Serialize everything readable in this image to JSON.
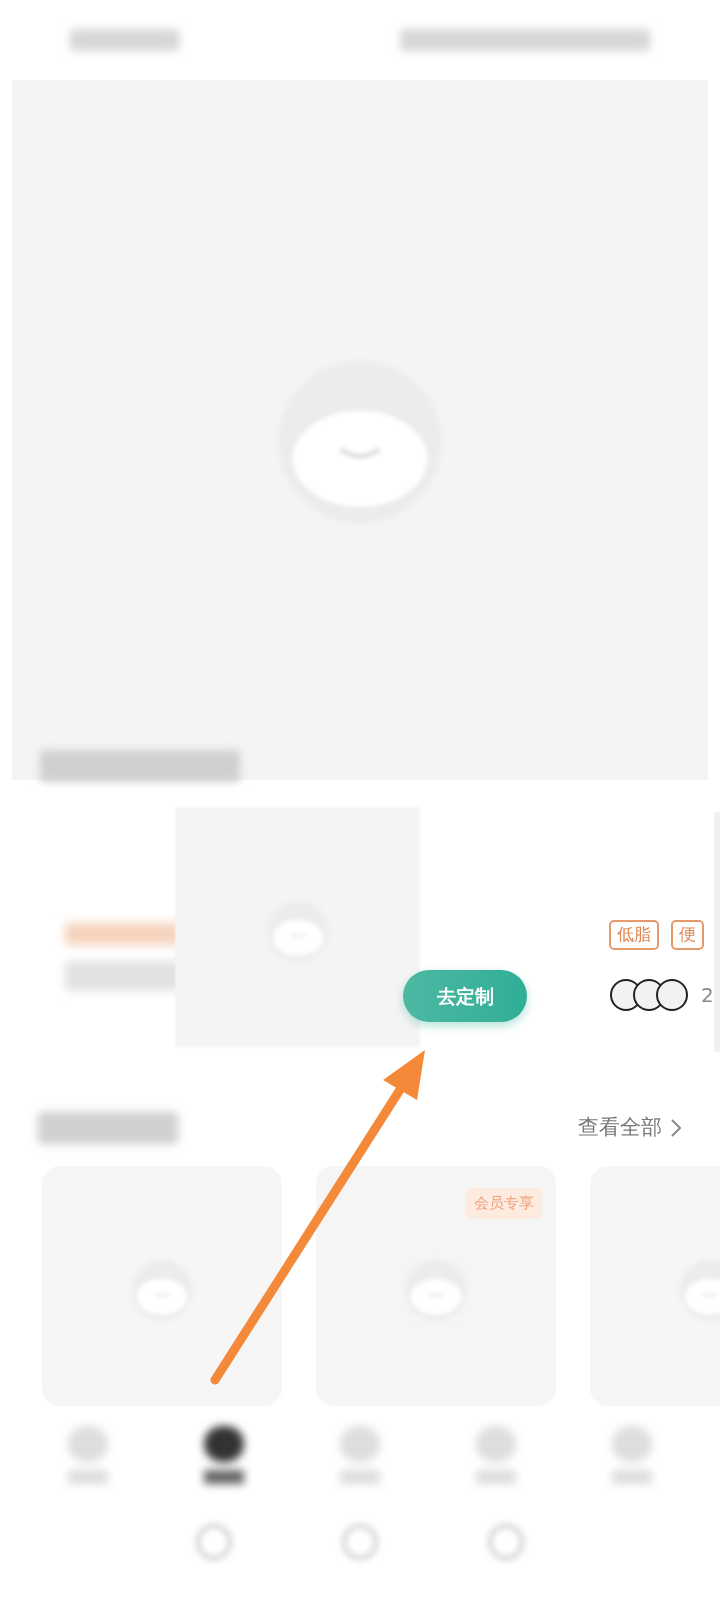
{
  "plan_card": {
    "button": "去定制",
    "tags": [
      "低脂",
      "便"
    ],
    "count": "2"
  },
  "section": {
    "view_all": "查看全部"
  },
  "recipes": [
    {
      "kind": "plain"
    },
    {
      "kind": "member",
      "badge": "会员专享"
    },
    {
      "kind": "plain"
    }
  ]
}
